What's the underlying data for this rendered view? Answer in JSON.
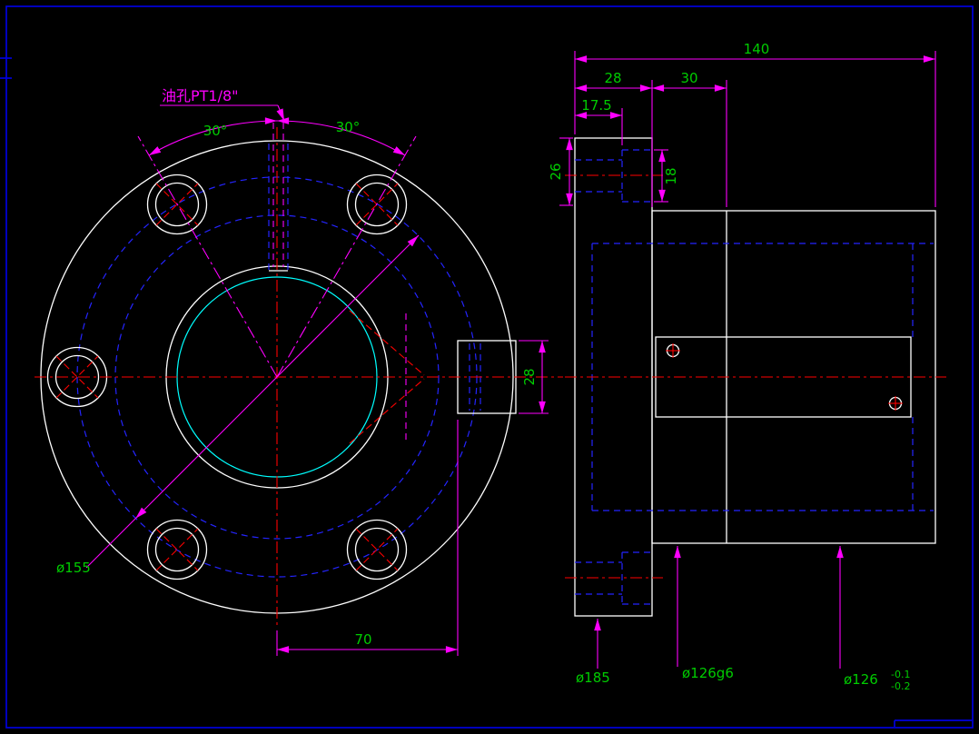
{
  "window": {
    "background": "#000000"
  },
  "colors": {
    "frame": "#0000dd",
    "outline": "#ffffff",
    "centerline": "#ff0000",
    "hidden_line": "#2424ff",
    "dimension_line": "#ff00ff",
    "dimension_text": "#00cc00",
    "bore_highlight": "#00ffff"
  },
  "front_view": {
    "oil_hole_label": "油孔PT1/8\"",
    "angle_left_label": "30°",
    "angle_right_label": "30°",
    "bolt_circle_label": "ø155",
    "key_offset_label": "70",
    "key_width_label": "28"
  },
  "side_view": {
    "overall_length_label": "140",
    "flange_thickness_label": "28",
    "step_length_label": "30",
    "counterbore_depth_label": "17.5",
    "edge_distance_label": "26",
    "hole_dia_label": "18",
    "flange_dia_label": "ø185",
    "spigot_dia_label": "ø126g6",
    "bore_dia_label": "ø126",
    "bore_tol_upper": "-0.1",
    "bore_tol_lower": "-0.2"
  }
}
